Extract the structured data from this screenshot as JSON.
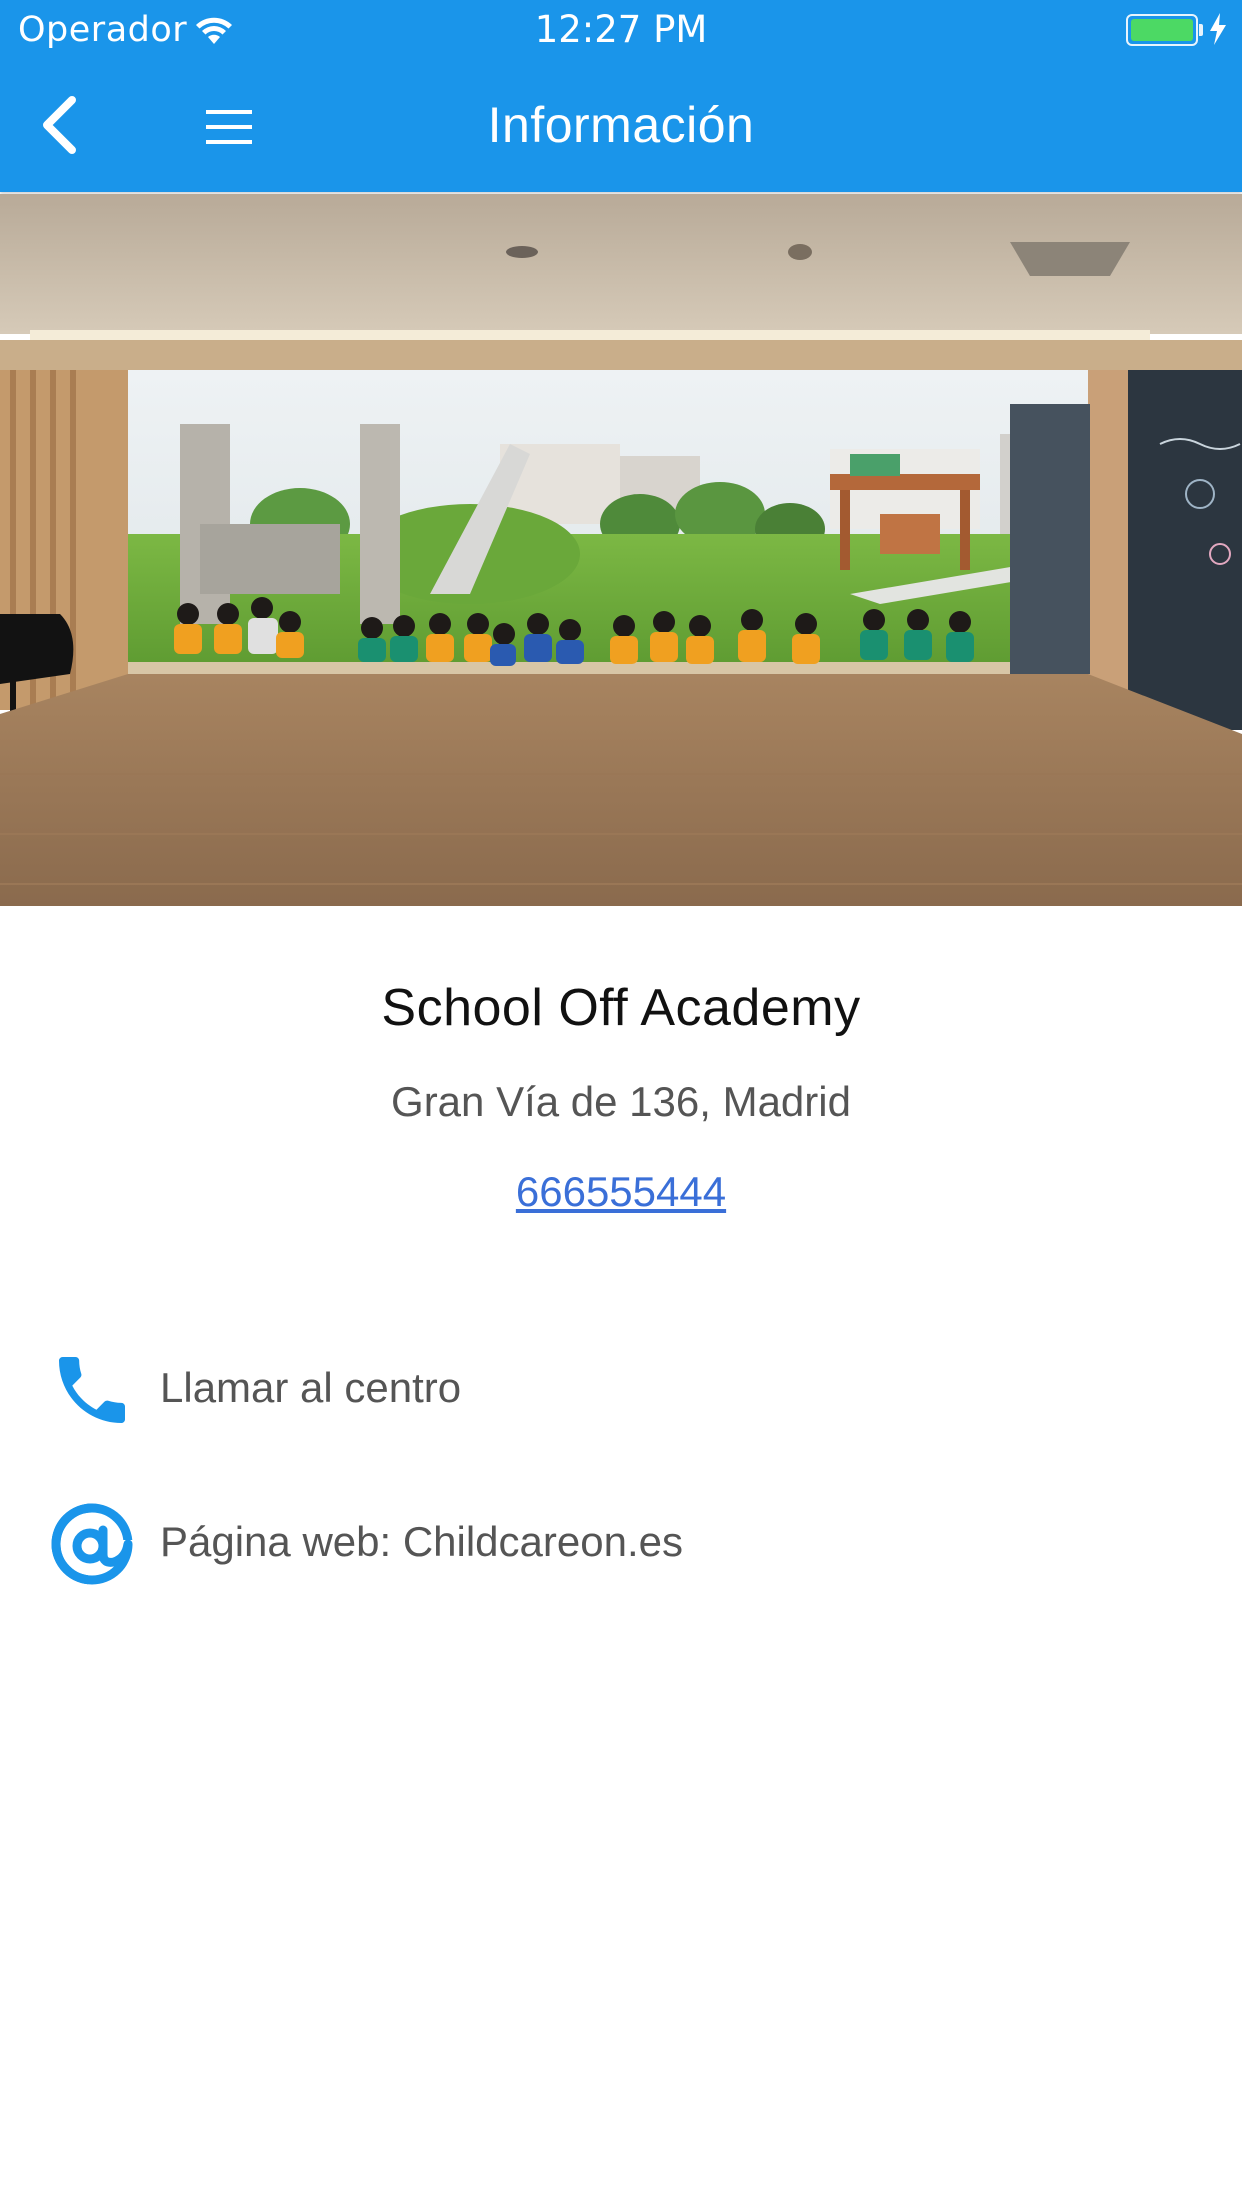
{
  "status_bar": {
    "carrier": "Operador",
    "time": "12:27 PM",
    "battery_color": "#4cd964",
    "wifi_icon": "wifi-icon",
    "charging_icon": "bolt-icon"
  },
  "nav": {
    "title": "Información",
    "back_icon": "chevron-left-icon",
    "menu_icon": "hamburger-menu-icon",
    "background_color": "#1a95ea"
  },
  "hero": {
    "image": "classroom-photo"
  },
  "school": {
    "name": "School Off Academy",
    "address": "Gran Vía de 136, Madrid",
    "phone": "666555444"
  },
  "actions": {
    "call": {
      "label": "Llamar al centro",
      "icon": "phone-icon"
    },
    "web": {
      "label": "Página web: Childcareon.es",
      "icon": "at-sign-icon"
    },
    "icon_color": "#1a95ea"
  }
}
